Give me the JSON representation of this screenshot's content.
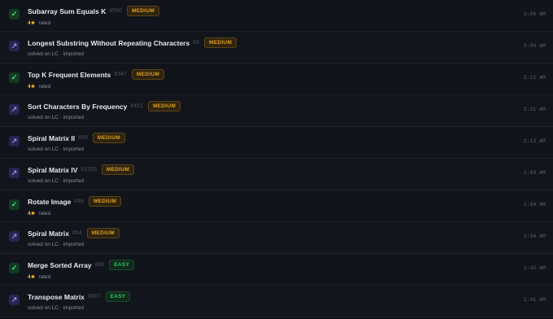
{
  "problems": [
    {
      "title": "Subarray Sum Equals K",
      "num": "#560",
      "difficulty": "MEDIUM",
      "kind": "check",
      "stars": "4★",
      "sub": "rated",
      "time": "3:06 AM"
    },
    {
      "title": "Longest Substring Without Repeating Characters",
      "num": "#3",
      "difficulty": "MEDIUM",
      "kind": "arrow",
      "stars": "",
      "sub": "solved on LC · imported",
      "time": "3:00 AM"
    },
    {
      "title": "Top K Frequent Elements",
      "num": "#347",
      "difficulty": "MEDIUM",
      "kind": "check",
      "stars": "4★",
      "sub": "rated",
      "time": "2:22 AM"
    },
    {
      "title": "Sort Characters By Frequency",
      "num": "#451",
      "difficulty": "MEDIUM",
      "kind": "arrow",
      "stars": "",
      "sub": "solved on LC · imported",
      "time": "2:21 AM"
    },
    {
      "title": "Spiral Matrix II",
      "num": "#59",
      "difficulty": "MEDIUM",
      "kind": "arrow",
      "stars": "",
      "sub": "solved on LC · imported",
      "time": "2:13 AM"
    },
    {
      "title": "Spiral Matrix IV",
      "num": "#2326",
      "difficulty": "MEDIUM",
      "kind": "arrow",
      "stars": "",
      "sub": "solved on LC · imported",
      "time": "2:09 AM"
    },
    {
      "title": "Rotate Image",
      "num": "#48",
      "difficulty": "MEDIUM",
      "kind": "check",
      "stars": "4★",
      "sub": "rated",
      "time": "1:54 AM"
    },
    {
      "title": "Spiral Matrix",
      "num": "#54",
      "difficulty": "MEDIUM",
      "kind": "arrow",
      "stars": "",
      "sub": "solved on LC · imported",
      "time": "1:54 AM"
    },
    {
      "title": "Merge Sorted Array",
      "num": "#88",
      "difficulty": "EASY",
      "kind": "check",
      "stars": "4★",
      "sub": "rated",
      "time": "1:42 AM"
    },
    {
      "title": "Transpose Matrix",
      "num": "#867",
      "difficulty": "EASY",
      "kind": "arrow",
      "stars": "",
      "sub": "solved on LC · imported",
      "time": "1:41 AM"
    }
  ],
  "icons": {
    "check": "✓",
    "arrow": "↗"
  }
}
